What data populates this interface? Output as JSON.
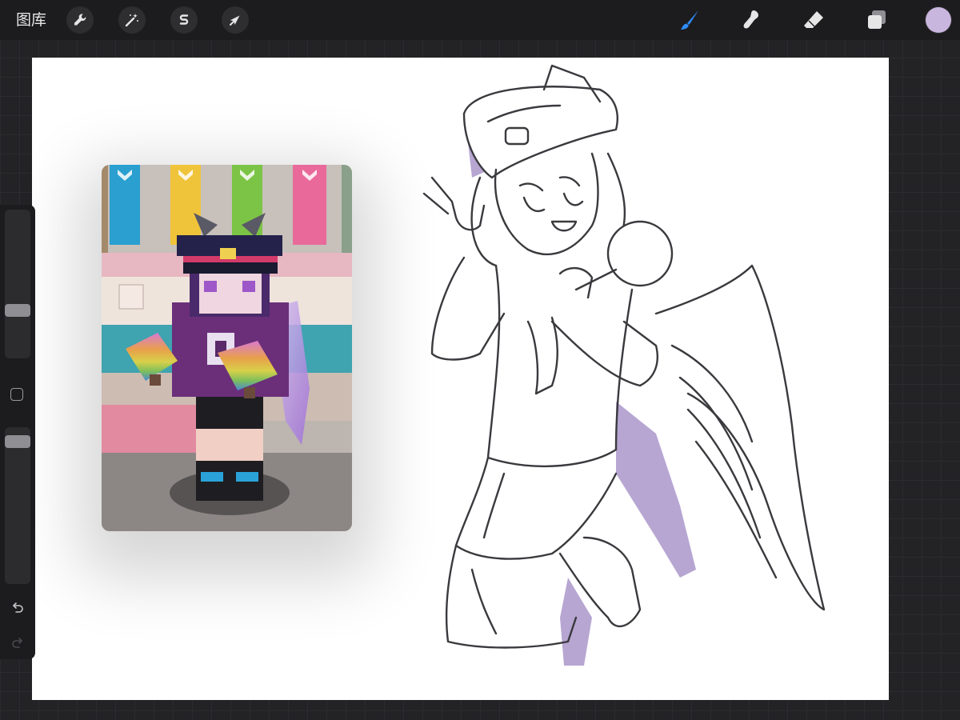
{
  "app": {
    "gallery_label": "图库"
  },
  "toolbar_left": [
    {
      "name": "actions",
      "icon": "wrench-icon"
    },
    {
      "name": "adjustments",
      "icon": "magic-wand-icon"
    },
    {
      "name": "selection",
      "icon": "selection-s-icon"
    },
    {
      "name": "transform",
      "icon": "arrow-cursor-icon"
    }
  ],
  "toolbar_right": [
    {
      "name": "brush",
      "icon": "brush-icon",
      "active": true
    },
    {
      "name": "smudge",
      "icon": "smudge-icon"
    },
    {
      "name": "eraser",
      "icon": "eraser-icon"
    },
    {
      "name": "layers",
      "icon": "layers-icon"
    },
    {
      "name": "color",
      "icon": "color-swatch"
    }
  ],
  "colors": {
    "accent_active": "#2f8cff",
    "current_color": "#c9b6de",
    "app_background": "#232326",
    "toolbar_background": "#1c1c1e",
    "canvas": "#ffffff",
    "sketch_fill": "#b7a6d2"
  },
  "sidebar": {
    "brush_size_level": 0.28,
    "opacity_level": 0.05,
    "undo_icon": "undo-icon",
    "redo_icon": "redo-icon",
    "modify_icon": "square-modify-icon"
  },
  "reference_image": {
    "subject": "reference-photo"
  }
}
